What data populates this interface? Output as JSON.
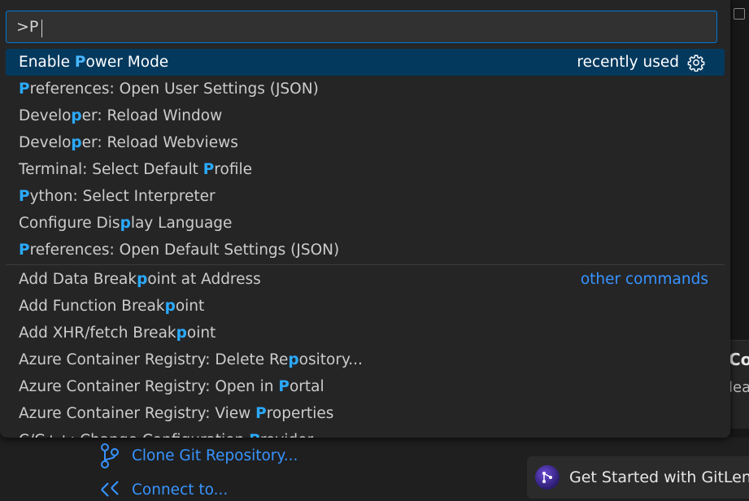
{
  "command_palette": {
    "input_value": ">P",
    "items": [
      {
        "parts": [
          {
            "t": "Enable "
          },
          {
            "t": "P",
            "h": true
          },
          {
            "t": "ower Mode"
          }
        ],
        "right_label": "recently used",
        "selected": true
      },
      {
        "parts": [
          {
            "t": "P",
            "h": true
          },
          {
            "t": "references: Open User Settings (JSON)"
          }
        ]
      },
      {
        "parts": [
          {
            "t": "Develo"
          },
          {
            "t": "p",
            "h": true
          },
          {
            "t": "er: Reload Window"
          }
        ]
      },
      {
        "parts": [
          {
            "t": "Develo"
          },
          {
            "t": "p",
            "h": true
          },
          {
            "t": "er: Reload Webviews"
          }
        ]
      },
      {
        "parts": [
          {
            "t": "Terminal: Select Default "
          },
          {
            "t": "P",
            "h": true
          },
          {
            "t": "rofile"
          }
        ]
      },
      {
        "parts": [
          {
            "t": "P",
            "h": true
          },
          {
            "t": "ython: Select Interpreter"
          }
        ]
      },
      {
        "parts": [
          {
            "t": "Configure Dis"
          },
          {
            "t": "p",
            "h": true
          },
          {
            "t": "lay Language"
          }
        ]
      },
      {
        "parts": [
          {
            "t": "P",
            "h": true
          },
          {
            "t": "references: Open Default Settings (JSON)"
          }
        ]
      }
    ],
    "other_label": "other commands",
    "other_items": [
      {
        "parts": [
          {
            "t": "Add Data Break"
          },
          {
            "t": "p",
            "h": true
          },
          {
            "t": "oint at Address"
          }
        ]
      },
      {
        "parts": [
          {
            "t": "Add Function Break"
          },
          {
            "t": "p",
            "h": true
          },
          {
            "t": "oint"
          }
        ]
      },
      {
        "parts": [
          {
            "t": "Add XHR/fetch Break"
          },
          {
            "t": "p",
            "h": true
          },
          {
            "t": "oint"
          }
        ]
      },
      {
        "parts": [
          {
            "t": "Azure Container Registry: Delete Re"
          },
          {
            "t": "p",
            "h": true
          },
          {
            "t": "ository..."
          }
        ]
      },
      {
        "parts": [
          {
            "t": "Azure Container Registry: Open in "
          },
          {
            "t": "P",
            "h": true
          },
          {
            "t": "ortal"
          }
        ]
      },
      {
        "parts": [
          {
            "t": "Azure Container Registry: View "
          },
          {
            "t": "P",
            "h": true
          },
          {
            "t": "roperties"
          }
        ]
      },
      {
        "parts": [
          {
            "t": "C/C++: Change Configuration "
          },
          {
            "t": "P",
            "h": true
          },
          {
            "t": "rovider"
          }
        ]
      }
    ]
  },
  "welcome": {
    "clone_label": "Clone Git Repository...",
    "connect_label": "Connect to...",
    "gitlens_label": "Get Started with GitLens",
    "partial_right_1": "Coc",
    "partial_right_2": "lea"
  },
  "colors": {
    "accent": "#0078d4",
    "highlight": "#2aaaff",
    "selected_bg": "#04395e",
    "link": "#3794ff"
  }
}
